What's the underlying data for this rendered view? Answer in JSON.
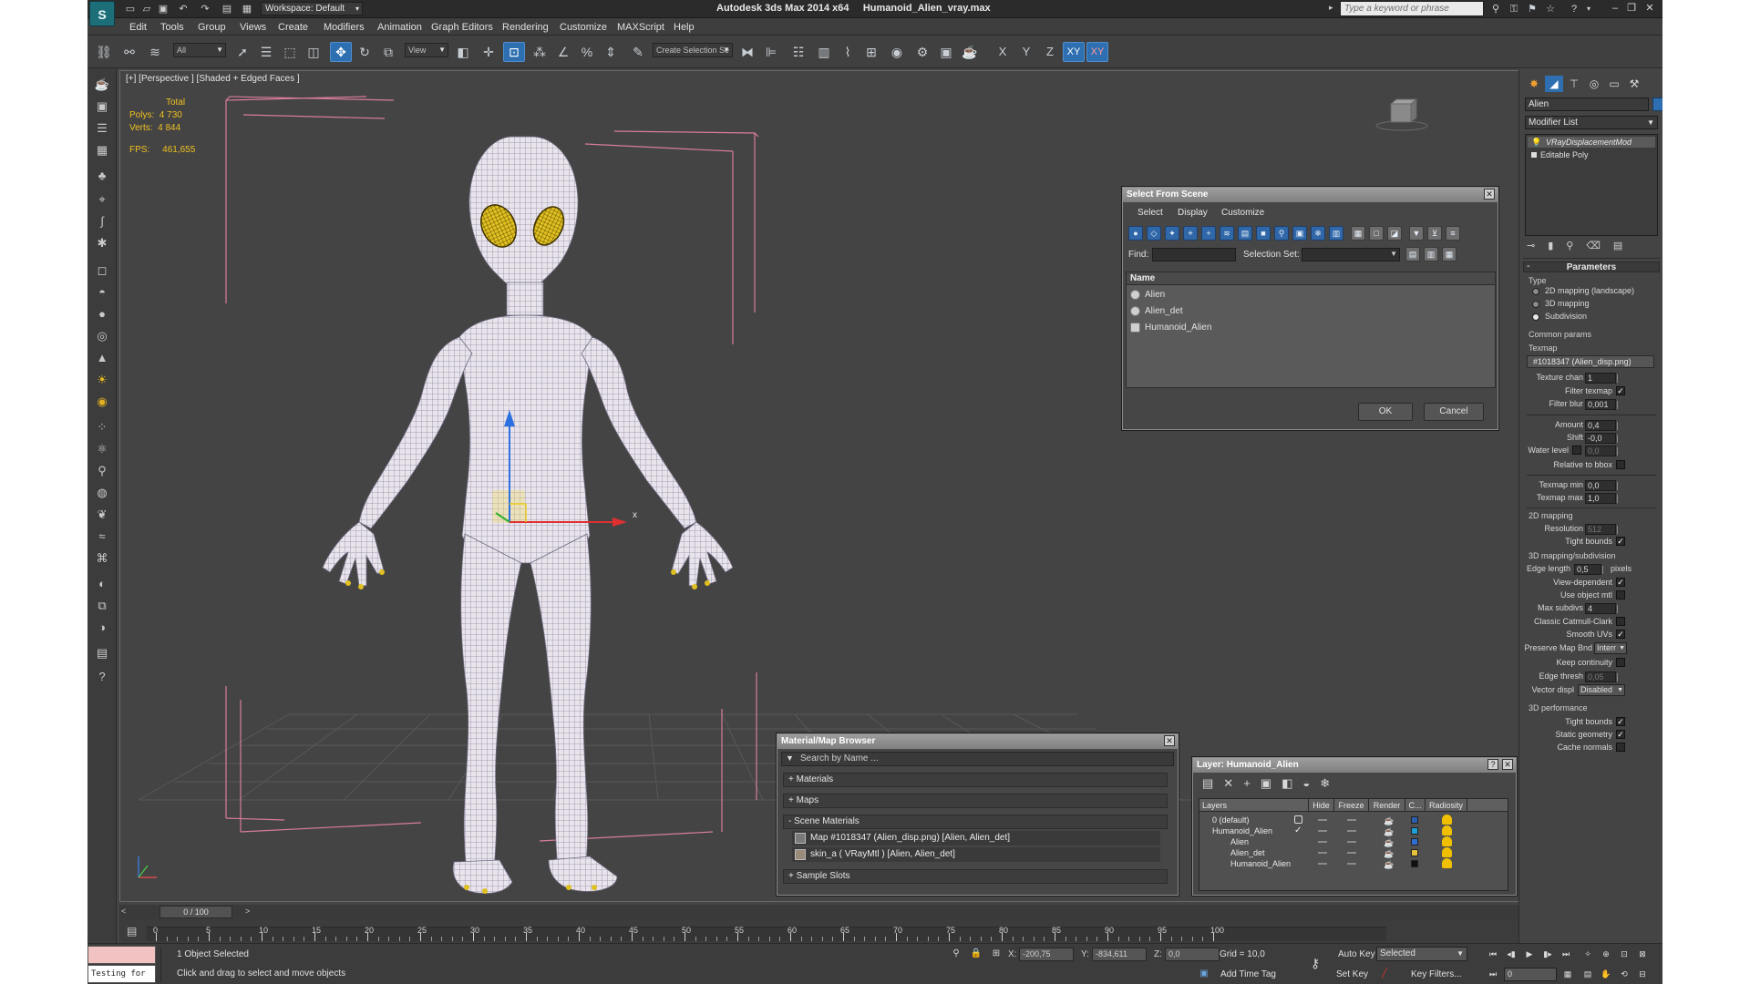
{
  "title": {
    "app": "Autodesk 3ds Max  2014 x64",
    "file": "Humanoid_Alien_vray.max",
    "workspace": "Workspace: Default",
    "search_placeholder": "Type a keyword or phrase"
  },
  "menu": [
    "Edit",
    "Tools",
    "Group",
    "Views",
    "Create",
    "Modifiers",
    "Animation",
    "Graph Editors",
    "Rendering",
    "Customize",
    "MAXScript",
    "Help"
  ],
  "toolbar": {
    "selection_filter": "All",
    "ref_coord": "View",
    "create_selection_set": "Create Selection Se",
    "axis_buttons": [
      "X",
      "Y",
      "Z",
      "XY",
      "XY"
    ]
  },
  "viewport": {
    "label": "[+] [Perspective ] [Shaded + Edged Faces ]",
    "stats": {
      "total_label": "Total",
      "polys_label": "Polys:",
      "polys": "4 730",
      "verts_label": "Verts:",
      "verts": "4 844",
      "fps_label": "FPS:",
      "fps": "461,655"
    },
    "axis_x": "x",
    "axis_z": "z"
  },
  "select_from_scene": {
    "title": "Select From Scene",
    "menu": [
      "Select",
      "Display",
      "Customize"
    ],
    "find_label": "Find:",
    "selection_set_label": "Selection Set:",
    "column": "Name",
    "items": [
      "Alien",
      "Alien_det",
      "Humanoid_Alien"
    ],
    "ok": "OK",
    "cancel": "Cancel"
  },
  "material_browser": {
    "title": "Material/Map Browser",
    "search_placeholder": "Search by Name ...",
    "groups": [
      "+ Materials",
      "+ Maps",
      "- Scene Materials"
    ],
    "scene_items": [
      "Map #1018347 (Alien_disp.png)  [Alien, Alien_det]",
      "skin_a  ( VRayMtl )  [Alien, Alien_det]"
    ],
    "sample_slots": "+ Sample Slots"
  },
  "layer_dialog": {
    "title": "Layer: Humanoid_Alien",
    "columns": [
      "Layers",
      "Hide",
      "Freeze",
      "Render",
      "C...",
      "Radiosity"
    ],
    "rows": [
      {
        "name": "0 (default)",
        "color": "#2a5fb0"
      },
      {
        "name": "Humanoid_Alien",
        "color": "#1f9fd5"
      },
      {
        "name": "Alien",
        "color": "#2f6fd0"
      },
      {
        "name": "Alien_det",
        "color": "#e7c23a"
      },
      {
        "name": "Humanoid_Alien",
        "color": "#111111"
      }
    ]
  },
  "command_panel": {
    "object_name": "Alien",
    "modifier_list": "Modifier List",
    "stack": [
      "VRayDisplacementMod",
      "Editable Poly"
    ],
    "rollout": "Parameters",
    "type_label": "Type",
    "types": [
      "2D mapping (landscape)",
      "3D mapping",
      "Subdivision"
    ],
    "common_params": "Common params",
    "texmap_label": "Texmap",
    "texmap_value": "#1018347 (Alien_disp.png)",
    "texture_chan_label": "Texture chan",
    "texture_chan": "1",
    "filter_texmap_label": "Filter texmap",
    "filter_blur_label": "Filter blur",
    "filter_blur": "0,001",
    "amount_label": "Amount",
    "amount": "0,4",
    "shift_label": "Shift",
    "shift": "-0,0",
    "water_level_label": "Water level",
    "water_level": "0,0",
    "relative_bbox_label": "Relative to bbox",
    "texmap_min_label": "Texmap min",
    "texmap_min": "0,0",
    "texmap_max_label": "Texmap max",
    "texmap_max": "1,0",
    "mapping2d_label": "2D mapping",
    "resolution_label": "Resolution",
    "resolution": "512",
    "tight_bounds_label": "Tight bounds",
    "mapping3d_label": "3D mapping/subdivision",
    "edge_length_label": "Edge length",
    "edge_length": "0,5",
    "pixels_label": "pixels",
    "view_dependent_label": "View-dependent",
    "use_object_mtl_label": "Use object mtl",
    "max_subdivs_label": "Max subdivs",
    "max_subdivs": "4",
    "catmull_label": "Classic Catmull-Clark",
    "smooth_uvs_label": "Smooth UVs",
    "preserve_label": "Preserve Map Bnd",
    "preserve_value": "Interr",
    "keep_continuity_label": "Keep continuity",
    "edge_thresh_label": "Edge thresh",
    "edge_thresh": "0,05",
    "vector_displ_label": "Vector displ",
    "vector_displ_value": "Disabled",
    "perf_label": "3D performance",
    "perf_tight_label": "Tight bounds",
    "static_geom_label": "Static geometry",
    "cache_normals_label": "Cache normals"
  },
  "timeline": {
    "slider": "0 / 100",
    "ticks": [
      "0",
      "5",
      "10",
      "15",
      "20",
      "25",
      "30",
      "35",
      "40",
      "45",
      "50",
      "55",
      "60",
      "65",
      "70",
      "75",
      "80",
      "85",
      "90",
      "95",
      "100"
    ]
  },
  "status": {
    "listener": "Testing for :",
    "objects": "1 Object Selected",
    "prompt": "Click and drag to select and move objects",
    "x_label": "X:",
    "x": "-200,75",
    "y_label": "Y:",
    "y": "-834,611",
    "z_label": "Z:",
    "z": "0,0",
    "grid": "Grid = 10,0",
    "add_time_tag": "Add Time Tag",
    "auto_key": "Auto Key",
    "set_key": "Set Key",
    "key_mode": "Selected",
    "key_filters": "Key Filters...",
    "frame": "0"
  }
}
